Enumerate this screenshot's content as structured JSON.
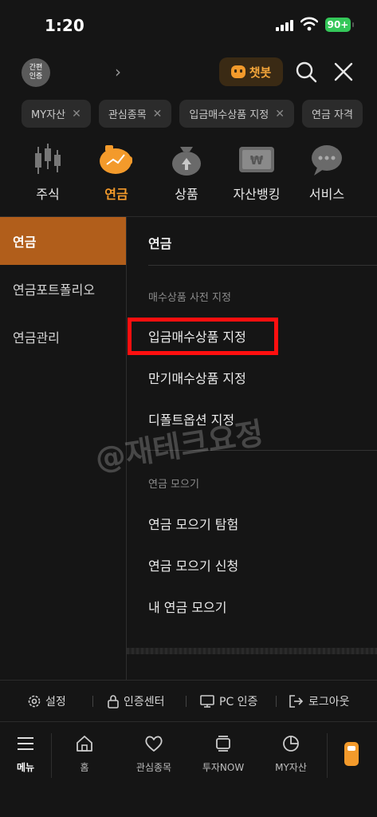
{
  "status": {
    "time": "1:20",
    "battery": "90+"
  },
  "header": {
    "auth_badge": "간편\n인증",
    "chatbot_label": "챗봇"
  },
  "chips": [
    "MY자산",
    "관심종목",
    "입금매수상품 지정",
    "연금 자격"
  ],
  "categories": [
    {
      "label": "주식",
      "icon": "candlestick-icon",
      "active": false
    },
    {
      "label": "연금",
      "icon": "piggy-bank-icon",
      "active": true
    },
    {
      "label": "상품",
      "icon": "money-bag-icon",
      "active": false
    },
    {
      "label": "자산뱅킹",
      "icon": "won-card-icon",
      "active": false
    },
    {
      "label": "서비스",
      "icon": "chat-bubble-icon",
      "active": false
    }
  ],
  "left_nav": [
    {
      "label": "연금",
      "active": true
    },
    {
      "label": "연금포트폴리오",
      "active": false
    },
    {
      "label": "연금관리",
      "active": false
    }
  ],
  "panel": {
    "title": "연금",
    "section1_label": "매수상품 사전 지정",
    "section1_items": [
      "입금매수상품 지정",
      "만기매수상품 지정",
      "디폴트옵션 지정"
    ],
    "section2_label": "연금 모으기",
    "section2_items": [
      "연금 모으기 탐험",
      "연금 모으기 신청",
      "내 연금 모으기"
    ]
  },
  "watermark": "@재테크요정",
  "utility": [
    "설정",
    "인증센터",
    "PC 인증",
    "로그아웃"
  ],
  "tabs": [
    {
      "label": "메뉴",
      "icon": "menu-icon",
      "active": true
    },
    {
      "label": "홈",
      "icon": "home-icon",
      "active": false
    },
    {
      "label": "관심종목",
      "icon": "heart-icon",
      "active": false
    },
    {
      "label": "투자NOW",
      "icon": "stack-icon",
      "active": false
    },
    {
      "label": "MY자산",
      "icon": "pie-chart-icon",
      "active": false
    }
  ],
  "colors": {
    "accent": "#f39a2b",
    "active_bg": "#b15e1b",
    "highlight": "#ff0f0f",
    "background": "#151515"
  }
}
